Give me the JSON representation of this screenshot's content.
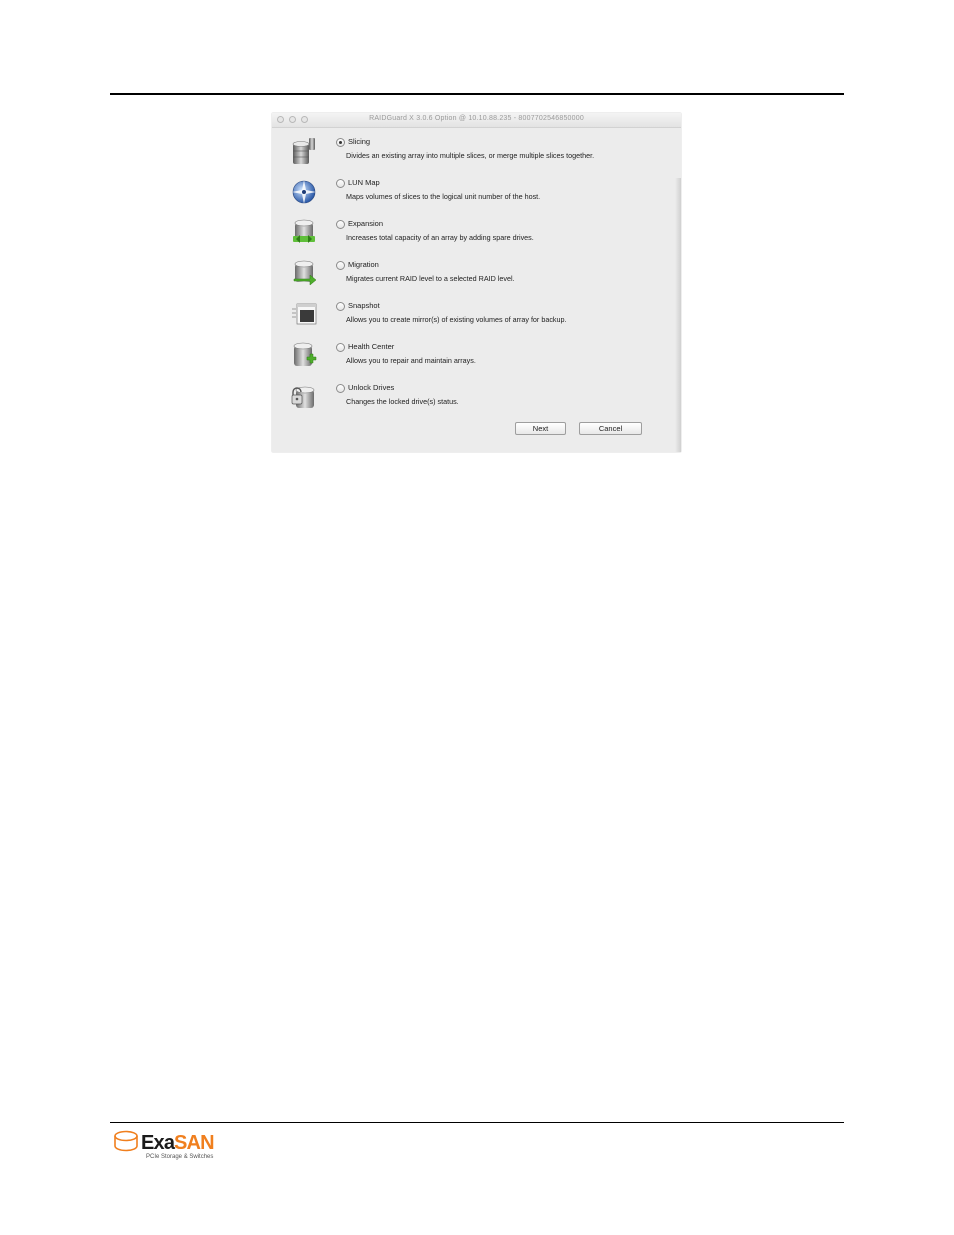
{
  "window": {
    "title": "RAIDGuard X 3.0.6 Option @ 10.10.88.235 - 8007702546850000"
  },
  "options": [
    {
      "label": "Slicing",
      "description": "Divides an existing array into multiple slices, or merge multiple slices together.",
      "selected": true,
      "icon": "slicing-icon"
    },
    {
      "label": "LUN Map",
      "description": "Maps volumes of slices to the logical unit number of the host.",
      "selected": false,
      "icon": "lun-map-icon"
    },
    {
      "label": "Expansion",
      "description": "Increases total capacity of an array by adding spare drives.",
      "selected": false,
      "icon": "expansion-icon"
    },
    {
      "label": "Migration",
      "description": "Migrates current RAID level to a selected RAID level.",
      "selected": false,
      "icon": "migration-icon"
    },
    {
      "label": "Snapshot",
      "description": "Allows you to create mirror(s) of existing volumes of array for backup.",
      "selected": false,
      "icon": "snapshot-icon"
    },
    {
      "label": "Health Center",
      "description": "Allows you to repair and maintain arrays.",
      "selected": false,
      "icon": "health-center-icon"
    },
    {
      "label": "Unlock Drives",
      "description": "Changes the locked drive(s) status.",
      "selected": false,
      "icon": "unlock-drives-icon"
    }
  ],
  "buttons": {
    "next": "Next",
    "cancel": "Cancel"
  },
  "footer": {
    "logo_name": "ExaSAN",
    "logo_prefix": "Exa",
    "logo_suffix": "SAN",
    "tagline": "PCIe Storage & Switches",
    "brand_color": "#f07f1e"
  }
}
